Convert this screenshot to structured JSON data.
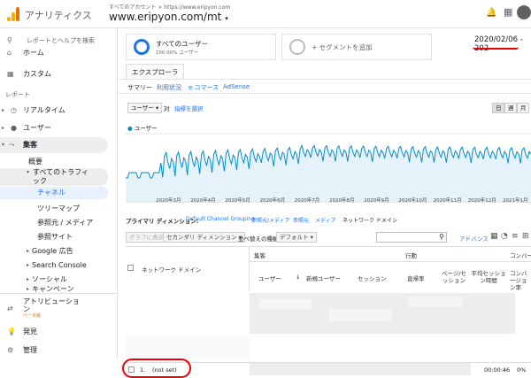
{
  "app": {
    "title": "アナリティクス",
    "crumb": "すべてのアカウント > https://www.eripyon.com",
    "property": "www.eripyon.com/mt"
  },
  "sidebar": {
    "search": "レポートとヘルプを検索",
    "home": "ホーム",
    "custom": "カスタム",
    "reports_section": "レポート",
    "realtime": "リアルタイム",
    "users": "ユーザー",
    "acquisition": "集客",
    "overview": "概要",
    "all_traffic": "すべてのトラフィ ック",
    "channels": "チャネル",
    "treemap": "ツリーマップ",
    "source_medium": "参照元 / メディア",
    "referrals": "参照サイト",
    "google_ads": "Google 広告",
    "search_console": "Search Console",
    "social": "ソーシャル",
    "campaigns": "キャンペーン",
    "attribution": "アトリビューショ ン",
    "beta": "ベータ版",
    "discover": "発見",
    "admin": "管理"
  },
  "segments": {
    "all_users": "すべてのユーザー",
    "all_users_pct": "100.00% ユーザー",
    "add_segment": "+ セグメントを追加",
    "date_range": "2020/02/06 - 202"
  },
  "explorer": {
    "tab": "エクスプローラ",
    "subtabs": [
      "サマリー",
      "利用状況",
      "e コマース",
      "AdSense"
    ],
    "metric_select": "ユーザー",
    "vs": "対",
    "choose_metric": "指標を選択",
    "periods": [
      "日",
      "週",
      "月"
    ],
    "legend": "ユーザー"
  },
  "chart_data": {
    "type": "line",
    "xlabels": [
      "2020年3月",
      "2020年4月",
      "2020年5月",
      "2020年6月",
      "2020年7月",
      "2020年8月",
      "2020年9月",
      "2020年10月",
      "2020年11月",
      "2020年12月",
      "2021年1月"
    ],
    "series": [
      {
        "name": "ユーザー"
      }
    ]
  },
  "dimensions": {
    "label": "プライマリ ディメンション:",
    "items": [
      "Default Channel Grouping",
      "参照元/メディア",
      "参照元",
      "メディア",
      "ネットワーク ドメイン"
    ]
  },
  "tools": {
    "plot": "グラフに表示",
    "secondary": "セカンダリ ディメンション",
    "sort_type": "並べ替えの種類:",
    "sort_default": "デフォルト",
    "advanced": "アドバンス"
  },
  "table": {
    "group_acq": "集客",
    "group_beh": "行動",
    "group_conv": "コンバージョン",
    "col_domain": "ネットワーク ドメイン",
    "cols": [
      "ユーザー",
      "新規ユーザー",
      "セッション",
      "直帰率",
      "ページ/セッション",
      "平均セッション時間",
      "コンバージョン率"
    ],
    "row1_index": "1.",
    "row1_name": "(not set)",
    "row1_time": "00:00:46",
    "row1_pct": "0%"
  }
}
